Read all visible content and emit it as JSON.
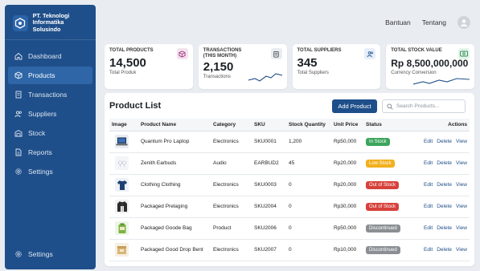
{
  "brand": {
    "line1": "PT. Teknologi",
    "line2": "Informatika Solusindo",
    "logo_icon": "hexagon-logo-icon"
  },
  "sidebar": {
    "items": [
      {
        "label": "Dashboard",
        "icon": "home-icon"
      },
      {
        "label": "Products",
        "icon": "box-icon",
        "active": true
      },
      {
        "label": "Transactions",
        "icon": "receipt-icon"
      },
      {
        "label": "Suppliers",
        "icon": "users-icon"
      },
      {
        "label": "Stock",
        "icon": "warehouse-icon"
      },
      {
        "label": "Reports",
        "icon": "document-icon"
      },
      {
        "label": "Settings",
        "icon": "gear-icon"
      }
    ],
    "bottom": {
      "label": "Settings",
      "icon": "gear-icon"
    }
  },
  "topbar": {
    "help": "Bantuan",
    "about": "Tentang",
    "avatar_icon": "user-avatar-icon"
  },
  "cards": [
    {
      "label": "TOTAL PRODUCTS",
      "value": "14,500",
      "sub": "Total Produk",
      "icon": "cube-icon",
      "accent": "#f3e3ef"
    },
    {
      "label_line1": "TRANSACTIONS",
      "label_line2": "(THIS MONTH)",
      "value": "2,150",
      "sub": "Transactions",
      "icon": "clipboard-icon",
      "accent": "#e9edf2"
    },
    {
      "label": "TOTAL SUPPLIERS",
      "value": "345",
      "sub": "Total Suppliers",
      "icon": "people-icon",
      "accent": "#e6eefa"
    },
    {
      "label": "TOTAL STOCK VALUE",
      "value": "Rp 8,500,000,000",
      "sub": "Currency Conversion",
      "icon": "money-icon",
      "accent": "#e3f5ea"
    }
  ],
  "product_list": {
    "title": "Product List",
    "add_button": "Add Product",
    "search_placeholder": "Search Products...",
    "columns": [
      "Image",
      "Product Name",
      "Category",
      "SKU",
      "Stock Quantity",
      "Unit Price",
      "Status",
      "Actions"
    ],
    "action_labels": {
      "edit": "Edit",
      "delete": "Delete",
      "view": "View"
    },
    "rows": [
      {
        "thumb": "laptop",
        "name": "Quantum Pro Laptop",
        "category": "Electronics",
        "sku": "SKU0001",
        "stock": "1,200",
        "price": "Rp50,000",
        "status": "In Stock",
        "status_color": "#3ca55c"
      },
      {
        "thumb": "earbuds",
        "name": "Zenith Earbuds",
        "category": "Audio",
        "sku": "EARBUD2",
        "stock": "45",
        "price": "Rp20,000",
        "status": "Low Stock",
        "status_color": "#f2b01e"
      },
      {
        "thumb": "shirt",
        "name": "Clothing Clothing",
        "category": "Electronics",
        "sku": "SKU0003",
        "stock": "0",
        "price": "Rp20,000",
        "status": "Out of Stock",
        "status_color": "#d6413b"
      },
      {
        "thumb": "jacket",
        "name": "Packaged Prelaging",
        "category": "Electronics",
        "sku": "SKU2004",
        "stock": "0",
        "price": "Rp30,000",
        "status": "Out of Stock",
        "status_color": "#d6413b"
      },
      {
        "thumb": "bag",
        "name": "Packaged Goode Bag",
        "category": "Product",
        "sku": "SKU2006",
        "stock": "0",
        "price": "Rp50,000",
        "status": "Discontinued",
        "status_color": "#8b8f94"
      },
      {
        "thumb": "box",
        "name": "Packaged Good Drop Bent",
        "category": "Electronics",
        "sku": "SKU2007",
        "stock": "0",
        "price": "Rp10,000",
        "status": "Discontinued",
        "status_color": "#8b8f94"
      }
    ]
  }
}
